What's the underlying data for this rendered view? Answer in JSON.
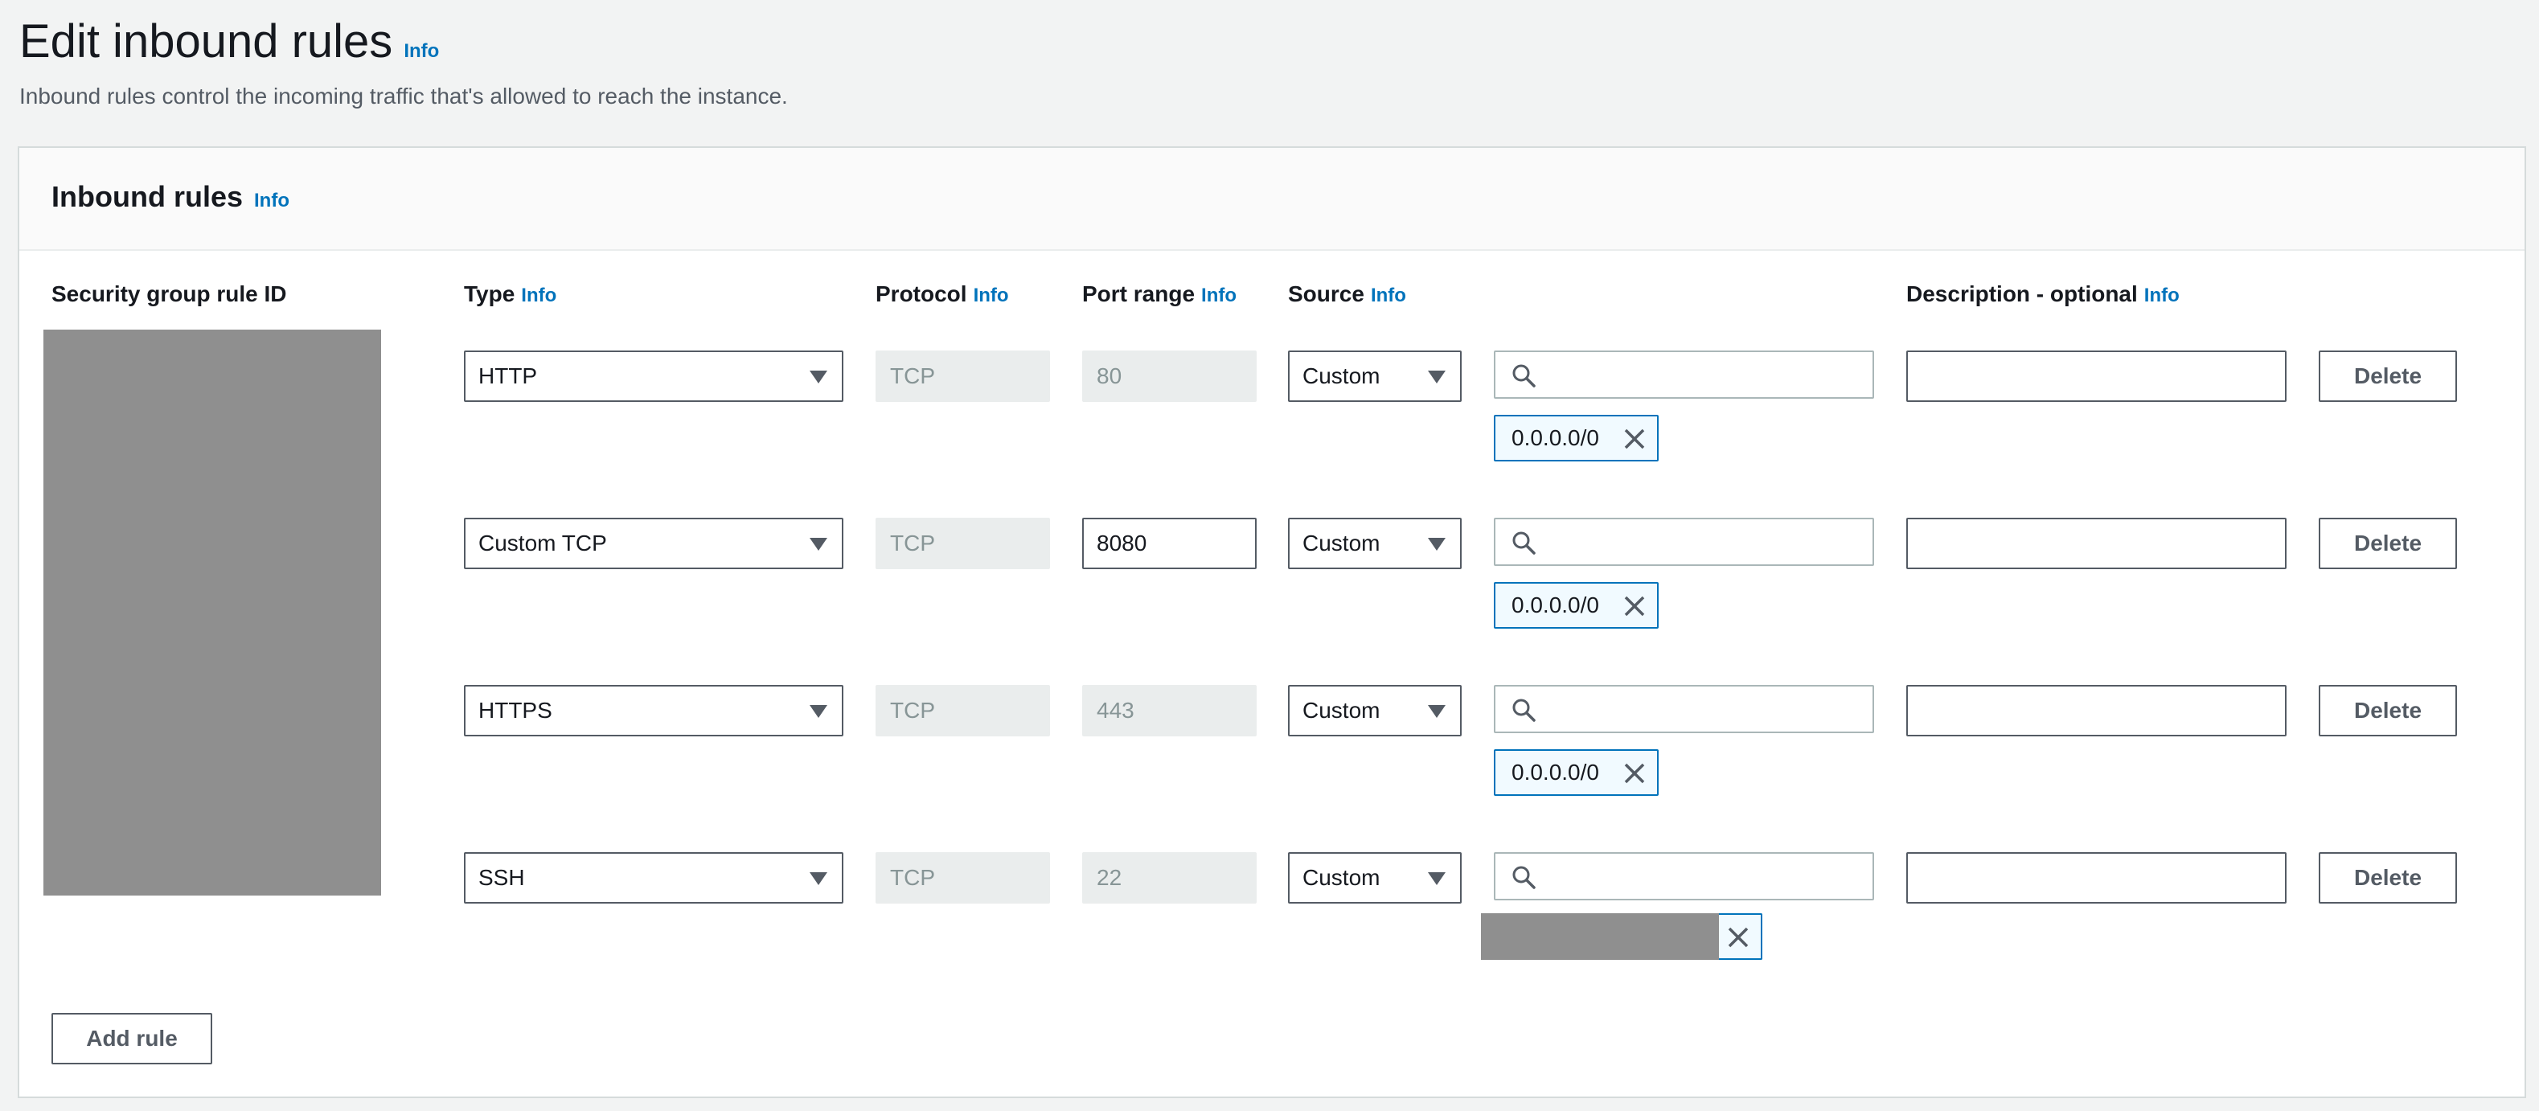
{
  "page": {
    "title": "Edit inbound rules",
    "title_info": "Info",
    "description": "Inbound rules control the incoming traffic that's allowed to reach the instance."
  },
  "panel": {
    "title": "Inbound rules",
    "title_info": "Info",
    "columns": {
      "rule_id": "Security group rule ID",
      "type": "Type",
      "protocol": "Protocol",
      "port_range": "Port range",
      "source": "Source",
      "description": "Description - optional",
      "info": "Info"
    },
    "rules": [
      {
        "type": "HTTP",
        "protocol": "TCP",
        "port": "80",
        "source": "Custom",
        "search": "",
        "token": "0.0.0.0/0",
        "description": "",
        "delete": "Delete"
      },
      {
        "type": "Custom TCP",
        "protocol": "TCP",
        "port": "8080",
        "source": "Custom",
        "search": "",
        "token": "0.0.0.0/0",
        "description": "",
        "delete": "Delete"
      },
      {
        "type": "HTTPS",
        "protocol": "TCP",
        "port": "443",
        "source": "Custom",
        "search": "",
        "token": "0.0.0.0/0",
        "description": "",
        "delete": "Delete"
      },
      {
        "type": "SSH",
        "protocol": "TCP",
        "port": "22",
        "source": "Custom",
        "search": "",
        "token": "",
        "description": "",
        "delete": "Delete"
      }
    ],
    "add_rule": "Add rule"
  },
  "icons": {
    "search": "search-icon",
    "close": "close-icon",
    "caret": "caret-down-icon"
  },
  "colors": {
    "info_link": "#0073bb",
    "token_border": "#0073bb",
    "token_bg": "#f1faff",
    "disabled_bg": "#eaeded",
    "redacted": "#8f8f8f"
  }
}
